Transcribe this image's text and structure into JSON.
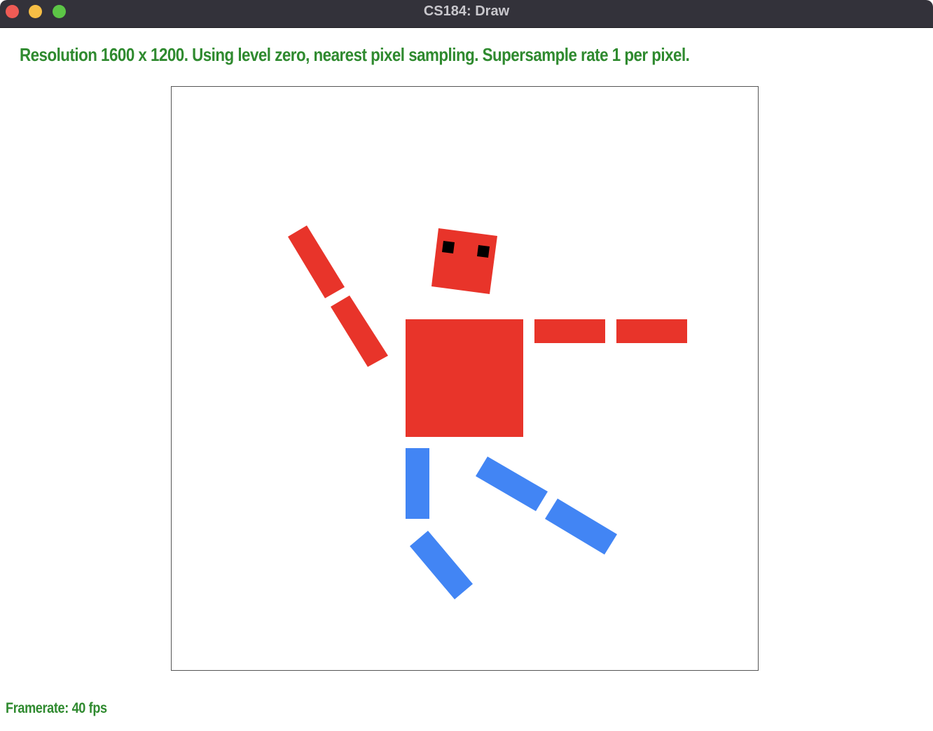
{
  "window": {
    "title": "CS184: Draw"
  },
  "hud": {
    "status": "Resolution 1600 x 1200. Using level zero, nearest pixel sampling. Supersample rate 1 per pixel.",
    "framerate": "Framerate: 40 fps"
  },
  "colors": {
    "body": "#e8342a",
    "legs": "#4285f4",
    "eyes": "#000000",
    "hud_text": "#2f8a2f",
    "titlebar": "#33323a"
  }
}
